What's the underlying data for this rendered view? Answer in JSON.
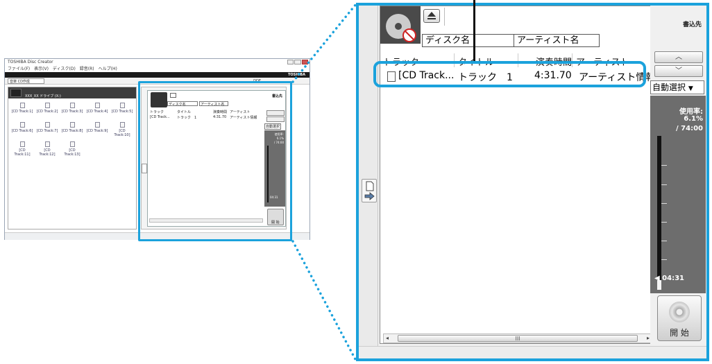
{
  "small_window": {
    "title": "TOSHIBA Disc Creator",
    "menu": "ファイル(F)　表示(V)　ディスク(D)　録音(R)　ヘルプ(H)",
    "brand": "TOSHIBA",
    "toolbar_mode": "音楽 CD作成",
    "toolbar_extra": "DDE",
    "drive": "XXX_XX ドライブ (X:)",
    "tracks": [
      "[CD Track:1]",
      "[CD Track:2]",
      "[CD Track:3]",
      "[CD Track:4]",
      "[CD Track:5]",
      "[CD Track:6]",
      "[CD Track:7]",
      "[CD Track:8]",
      "[CD Track:9]",
      "[CD Track:10]",
      "[CD Track:11]",
      "[CD Track:12]",
      "[CD Track:13]"
    ],
    "panel": {
      "disc_name": "ディスク名",
      "artist_name": "アーティスト名",
      "write_to": "書込先",
      "col_track": "トラック",
      "col_title": "タイトル",
      "col_time": "演奏時間",
      "col_artist": "アーティスト",
      "row_track": "[CD Track...",
      "row_title": "トラック　1",
      "row_time": "4:31.70",
      "row_artist": "アーティスト情報",
      "auto_select": "自動選択",
      "usage_label": "使用率:",
      "usage_pct": "6.1%",
      "usage_total": "/ 74:00",
      "elapsed": "04:31",
      "start": "開 始"
    }
  },
  "zoom": {
    "write_to": "書込先",
    "disc_name": "ディスク名",
    "artist_name": "アーティスト名",
    "columns": {
      "track": "トラック",
      "title": "タイトル",
      "time": "演奏時間",
      "artist": "アーティスト"
    },
    "row": {
      "track": "[CD Track...",
      "title": "トラック　1",
      "time": "4:31.70",
      "artist": "アーティスト情報."
    },
    "auto_select": "自動選択",
    "usage_label": "使用率:",
    "usage_pct": "6.1%",
    "usage_total": "/ 74:00",
    "elapsed": "04:31",
    "start": "開 始",
    "scroll_grip": "III"
  },
  "colors": {
    "highlight": "#1ba2dc",
    "gauge_bg": "#6d6d6d"
  },
  "icons": [
    "disc-icon",
    "eject-icon",
    "audio-file-icon",
    "chevron-up-icon",
    "chevron-down-icon",
    "dropdown-arrow-icon",
    "meter-marker-icon",
    "add-to-disc-icon",
    "burn-disc-icon",
    "scroll-left-icon",
    "scroll-right-icon"
  ]
}
